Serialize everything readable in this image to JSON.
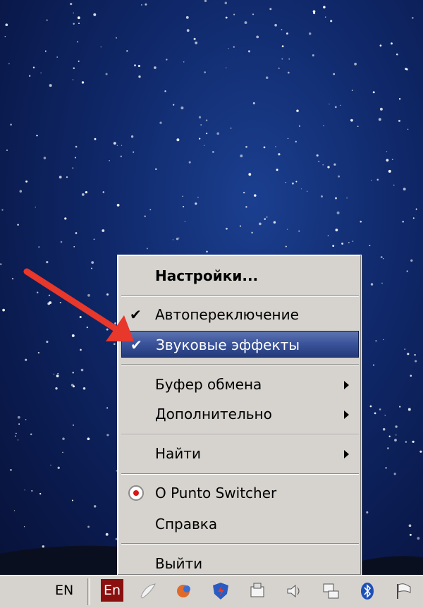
{
  "context_menu": {
    "settings": "Настройки...",
    "auto_switch": "Автопереключение",
    "sound_effects": "Звуковые эффекты",
    "clipboard": "Буфер обмена",
    "additional": "Дополнительно",
    "find": "Найти",
    "about": "О Punto Switcher",
    "help": "Справка",
    "exit": "Выйти",
    "check_mark": "✔"
  },
  "taskbar": {
    "language": "EN",
    "punto_indicator": "En"
  },
  "colors": {
    "highlight": "#3c559c",
    "annotation_arrow": "#e8372b",
    "indicator_bg": "#8a1010"
  }
}
